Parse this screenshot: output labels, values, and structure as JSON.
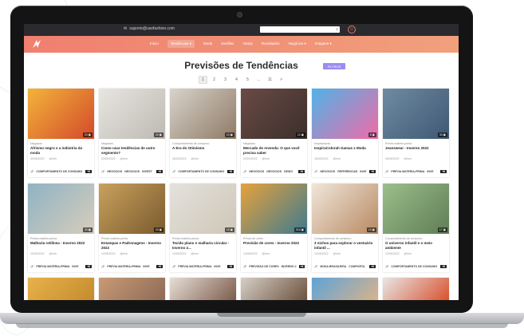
{
  "topbar": {
    "email": "suporte@usefashion.com"
  },
  "nav": {
    "items": [
      "Início",
      "Tendências",
      "Moda",
      "Desfiles",
      "Varejo",
      "Resultados",
      "Negócios",
      "Imagens"
    ],
    "active_index": 1
  },
  "page": {
    "title": "Previsões de Tendências",
    "filter_button": "FILTROS"
  },
  "pagination": {
    "pages": [
      "1",
      "2",
      "3",
      "4",
      "5",
      "...",
      "11",
      ">"
    ],
    "current": "1"
  },
  "cards": [
    {
      "category": "Negócios",
      "title": "Afrismo negro e a indústria da moda",
      "date": "30/05/2022",
      "author": "@Imh",
      "tags": [
        "COMPORTAMENTO DE CONSUMO"
      ],
      "badge": "23",
      "colors": [
        "#f2b43a",
        "#d4492b"
      ]
    },
    {
      "category": "Negócios",
      "title": "Como usar tendências de outro segmento?",
      "date": "03/05/2022",
      "author": "@Imh",
      "tags": [
        "NEGÓCIOS",
        "NEGÓCIOS",
        "INVEST"
      ],
      "badge": "23",
      "colors": [
        "#e8e6e1",
        "#bdb9b2"
      ]
    },
    {
      "category": "Comportamento de consumo",
      "title": "A Era do Otimismo",
      "date": "26/05/2022",
      "author": "@Imh",
      "tags": [
        "COMPORTAMENTO DE CONSUMO"
      ],
      "badge": "13",
      "colors": [
        "#d8d3cc",
        "#8f7a65"
      ]
    },
    {
      "category": "Negócios",
      "title": "Mercado de revenda: O que você precisa saber",
      "date": "20/04/2022",
      "author": "@Imh",
      "tags": [
        "NEGÓCIOS",
        "NEGÓCIOS",
        "DESIG"
      ],
      "badge": "12",
      "colors": [
        "#6b4a45",
        "#3a2f2b"
      ]
    },
    {
      "category": "Inspiracional",
      "title": "InspiraColorah Gamas x Moda",
      "date": "18/05/2022",
      "author": "@Imh",
      "tags": [
        "NEGÓCIOS",
        "REFERÊNCIAS",
        "INVE"
      ],
      "badge": "8",
      "colors": [
        "#4fb3e8",
        "#f06ba7"
      ]
    },
    {
      "category": "Prévia matéria prima",
      "title": "Jeanswear - Inverno 2022",
      "date": "08/05/2022",
      "author": "@Imh",
      "tags": [
        "PRÉVIA MATÉRIA-PRIMA",
        "INVE"
      ],
      "badge": "33",
      "colors": [
        "#6f8aa3",
        "#3f5873"
      ]
    },
    {
      "category": "Prévia matéria prima",
      "title": "Malharia retilínea - Inverno 2022",
      "date": "10/05/2022",
      "author": "@Imh",
      "tags": [
        "PRÉVIA MATÉRIA-PRIMA",
        "INVE"
      ],
      "badge": "33",
      "colors": [
        "#8fb3c4",
        "#d7cdbb"
      ]
    },
    {
      "category": "Prévia matéria prima",
      "title": "Estampas e Padronagens - Inverno 2022",
      "date": "10/05/2022",
      "author": "@Imh",
      "tags": [
        "PRÉVIA MATÉRIA-PRIMA",
        "INVE"
      ],
      "badge": "23",
      "colors": [
        "#c9a15d",
        "#7a5a2e"
      ]
    },
    {
      "category": "Prévia matéria prima",
      "title": "Tecido plano e malharia circular - Inverno 2...",
      "date": "10/05/2022",
      "author": "@Imh",
      "tags": [
        "PRÉVIA MATÉRIA-PRIMA",
        "INVE"
      ],
      "badge": "15",
      "colors": [
        "#e3e2dd",
        "#cfc6b6"
      ]
    },
    {
      "category": "Prévia de cores",
      "title": "Previsão de cores - Inverno 2022",
      "date": "10/05/2022",
      "author": "@Imh",
      "tags": [
        "PREVISÃO DE CORES",
        "INVERNO 2"
      ],
      "badge": "213",
      "colors": [
        "#e6a23b",
        "#3e7a8f"
      ]
    },
    {
      "category": "Comportamento de consumo",
      "title": "3 nichos para explorar o vestuário infantil ...",
      "date": "10/05/2022",
      "author": "@Imh",
      "tags": [
        "MODA BRASILEIRA",
        "COMPORTA"
      ],
      "badge": "13",
      "colors": [
        "#f0e6da",
        "#b88a63"
      ]
    },
    {
      "category": "Comportamento de consumo",
      "title": "O universo infantil e o meio ambiente",
      "date": "10/05/2022",
      "author": "@Imh",
      "tags": [
        "COMPORTAMENTO DE CONSUMO"
      ],
      "badge": "17",
      "colors": [
        "#9bbf8a",
        "#5f7d56"
      ]
    }
  ],
  "peek_colors": [
    [
      "#e8b24a",
      "#c48a2e"
    ],
    [
      "#c99a76",
      "#8c6a55"
    ],
    [
      "#e7ded5",
      "#7a5a4a"
    ],
    [
      "#d6cfc6",
      "#6a4f3b"
    ],
    [
      "#5fa3d8",
      "#d9b38a"
    ],
    [
      "#e8e6e4",
      "#d8502d"
    ]
  ]
}
